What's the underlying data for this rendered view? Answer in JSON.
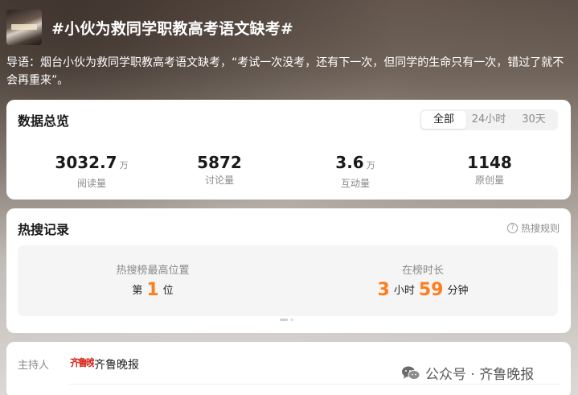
{
  "topic": {
    "title": "#小伙为救同学职教高考语文缺考#",
    "lead": "导语：烟台小伙为救同学职教高考语文缺考，“考试一次没考，还有下一次，但同学的生命只有一次，错过了就不会再重来”。"
  },
  "overview": {
    "title": "数据总览",
    "tabs": [
      "全部",
      "24小时",
      "30天"
    ],
    "active_tab": "全部",
    "stats": [
      {
        "value": "3032.7",
        "unit": "万",
        "label": "阅读量"
      },
      {
        "value": "5872",
        "unit": "",
        "label": "讨论量"
      },
      {
        "value": "3.6",
        "unit": "万",
        "label": "互动量"
      },
      {
        "value": "1148",
        "unit": "",
        "label": "原创量"
      }
    ]
  },
  "hot_search": {
    "title": "热搜记录",
    "rules_link": "热搜规则",
    "rules_icon": "question-circle-icon",
    "best_rank": {
      "label": "热搜榜最高位置",
      "prefix": "第",
      "value": "1",
      "suffix": "位"
    },
    "duration": {
      "label": "在榜时长",
      "hours": "3",
      "hours_unit": "小时",
      "minutes": "59",
      "minutes_unit": "分钟"
    },
    "accent_color": "#ff7d1a"
  },
  "host": {
    "label": "主持人",
    "logo_text": "齐鲁晚报",
    "name": "齐鲁晚报"
  },
  "watermark": {
    "icon": "wechat-icon",
    "text": "公众号 · 齐鲁晚报"
  }
}
